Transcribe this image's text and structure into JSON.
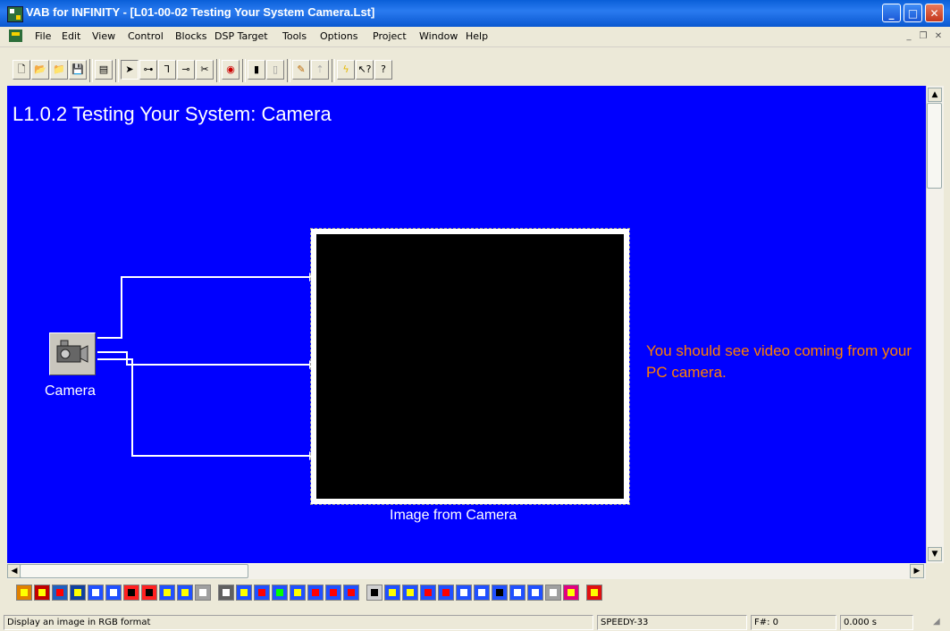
{
  "window": {
    "title": "VAB for INFINITY - [L01-00-02 Testing Your System Camera.Lst]",
    "app_icon": "vab-app-icon",
    "controls": [
      "minimize-icon",
      "maximize-icon",
      "close-icon"
    ]
  },
  "menubar": {
    "items": [
      "File",
      "Edit",
      "View",
      "Control",
      "Blocks",
      "DSP Target",
      "Tools",
      "Options",
      "Project",
      "Window",
      "Help"
    ]
  },
  "toolbar": {
    "buttons": [
      "new-icon",
      "open-icon",
      "open-folder-icon",
      "save-icon",
      "properties-icon",
      "select-arrow-icon",
      "connect-icon",
      "connect-branch-icon",
      "connect-end-icon",
      "cut-wire-icon",
      "run-target-icon",
      "pause-icon",
      "step-icon",
      "pencil-icon",
      "pointer-up-icon",
      "lightning-icon",
      "context-help-icon",
      "help-icon"
    ]
  },
  "canvas": {
    "background": "#0000ff",
    "title": "L1.0.2 Testing Your System: Camera",
    "instructions": "You should see video coming from your PC camera.",
    "instruction_color": "#ff8000",
    "blocks": {
      "camera": {
        "label": "Camera",
        "icon": "video-camera-icon"
      },
      "display": {
        "label": "Image from Camera"
      }
    }
  },
  "palette": {
    "blocks": [
      "palette-block-1",
      "palette-block-2",
      "palette-block-3",
      "palette-block-4",
      "palette-block-5",
      "palette-block-6",
      "palette-block-7",
      "palette-block-8",
      "palette-block-9",
      "palette-block-10",
      "palette-block-11",
      "palette-block-12",
      "palette-block-13",
      "palette-block-14",
      "palette-block-15",
      "palette-block-16",
      "palette-block-17",
      "palette-block-18",
      "palette-block-19",
      "palette-block-20",
      "palette-block-21",
      "palette-block-22",
      "palette-block-23",
      "palette-block-24",
      "palette-block-25",
      "palette-block-26",
      "palette-block-27",
      "palette-block-28",
      "palette-block-29",
      "palette-block-30",
      "palette-block-31",
      "palette-block-32"
    ]
  },
  "statusbar": {
    "message": "Display an image in RGB format",
    "target": "SPEEDY-33",
    "frame": "F#: 0",
    "time": "0.000 s"
  }
}
